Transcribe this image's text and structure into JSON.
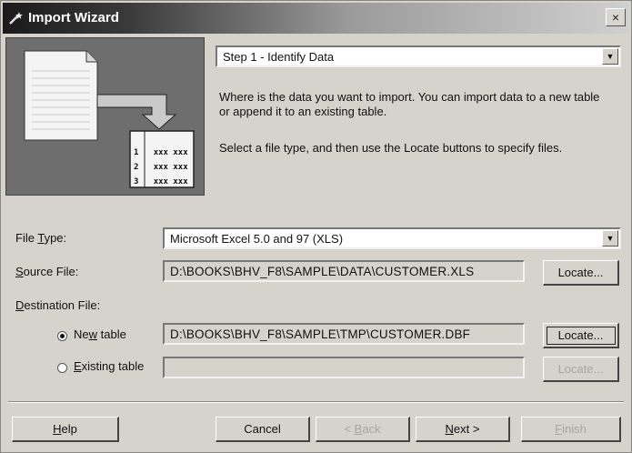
{
  "window": {
    "title": "Import Wizard",
    "close_label": "×"
  },
  "step_select": {
    "value": "Step 1 - Identify Data"
  },
  "instructions": {
    "paragraph1": "Where is the data you want to import. You can import data to a new table or append it to an existing table.",
    "paragraph2": "Select a file type, and then use the Locate buttons to specify files."
  },
  "illustration": {
    "rows": [
      {
        "num": "1",
        "text": "xxx xxx"
      },
      {
        "num": "2",
        "text": "xxx xxx"
      },
      {
        "num": "3",
        "text": "xxx xxx"
      }
    ]
  },
  "file_type": {
    "label_pre": "File ",
    "label_key": "T",
    "label_post": "ype:",
    "value": "Microsoft Excel 5.0 and 97 (XLS)"
  },
  "source_file": {
    "label_pre": "",
    "label_key": "S",
    "label_post": "ource File:",
    "value": "D:\\BOOKS\\BHV_F8\\SAMPLE\\DATA\\CUSTOMER.XLS",
    "locate_label": "Locate..."
  },
  "destination": {
    "label_pre": "",
    "label_key": "D",
    "label_post": "estination File:",
    "new_table": {
      "label_pre": "Ne",
      "label_key": "w",
      "label_post": " table",
      "selected": true,
      "value": "D:\\BOOKS\\BHV_F8\\SAMPLE\\TMP\\CUSTOMER.DBF",
      "locate_label": "Locate..."
    },
    "existing_table": {
      "label_pre": "",
      "label_key": "E",
      "label_post": "xisting table",
      "selected": false,
      "value": "",
      "locate_label": "Locate..."
    }
  },
  "buttons": {
    "help": {
      "pre": "",
      "key": "H",
      "post": "elp"
    },
    "cancel": {
      "label": "Cancel"
    },
    "back": {
      "pre": "< ",
      "key": "B",
      "post": "ack"
    },
    "next": {
      "pre": "",
      "key": "N",
      "post": "ext >"
    },
    "finish": {
      "pre": "",
      "key": "F",
      "post": "inish"
    }
  },
  "colors": {
    "titlebar_dark": "#1a1a1a",
    "dialog_bg": "#d6d3cc",
    "illustration_bg": "#6e6e6e"
  }
}
